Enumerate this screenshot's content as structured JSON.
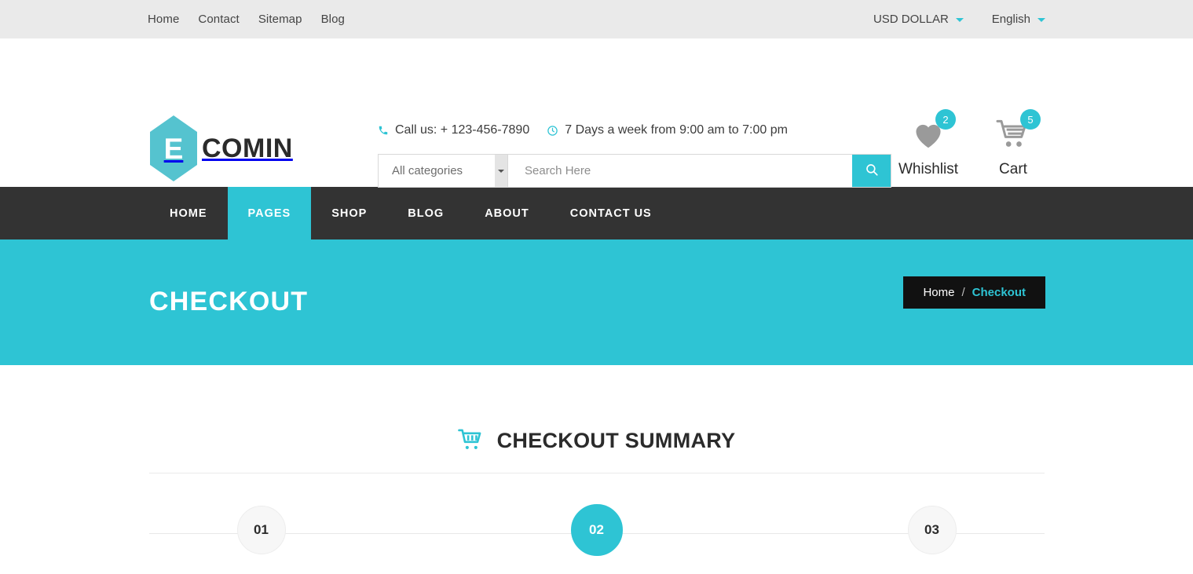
{
  "topbar": {
    "links": [
      {
        "label": "Home"
      },
      {
        "label": "Contact"
      },
      {
        "label": "Sitemap"
      },
      {
        "label": "Blog"
      }
    ],
    "currency": "USD DOLLAR",
    "language": "English"
  },
  "header": {
    "logo_mark": "E",
    "logo_text": "COMIN",
    "phone": "Call us: + 123-456-7890",
    "hours": "7 Days a week from 9:00 am to 7:00 pm",
    "search": {
      "category_selected": "All categories",
      "category_options": [
        "All categories"
      ],
      "placeholder": "Search Here",
      "value": ""
    },
    "wishlist": {
      "label": "Whishlist",
      "count": "2"
    },
    "cart": {
      "label": "Cart",
      "count": "5"
    }
  },
  "nav": {
    "items": [
      {
        "label": "HOME",
        "active": false
      },
      {
        "label": "PAGES",
        "active": true
      },
      {
        "label": "SHOP",
        "active": false
      },
      {
        "label": "BLOG",
        "active": false
      },
      {
        "label": "ABOUT",
        "active": false
      },
      {
        "label": "CONTACT US",
        "active": false
      }
    ]
  },
  "banner": {
    "title": "CHECKOUT",
    "breadcrumb": {
      "home": "Home",
      "separator": "/",
      "current": "Checkout"
    }
  },
  "summary": {
    "title": "CHECKOUT SUMMARY",
    "icon": "shopping-cart-icon",
    "steps": [
      {
        "number": "01",
        "active": false
      },
      {
        "number": "02",
        "active": true
      },
      {
        "number": "03",
        "active": false
      }
    ]
  },
  "colors": {
    "accent": "#2ec4d4",
    "accent_logo": "#55c3cf",
    "dark_nav": "#333333",
    "topbar_bg": "#eaeaea",
    "breadcrumb_bg": "#111111",
    "icon_gray": "#9a9a9a"
  }
}
